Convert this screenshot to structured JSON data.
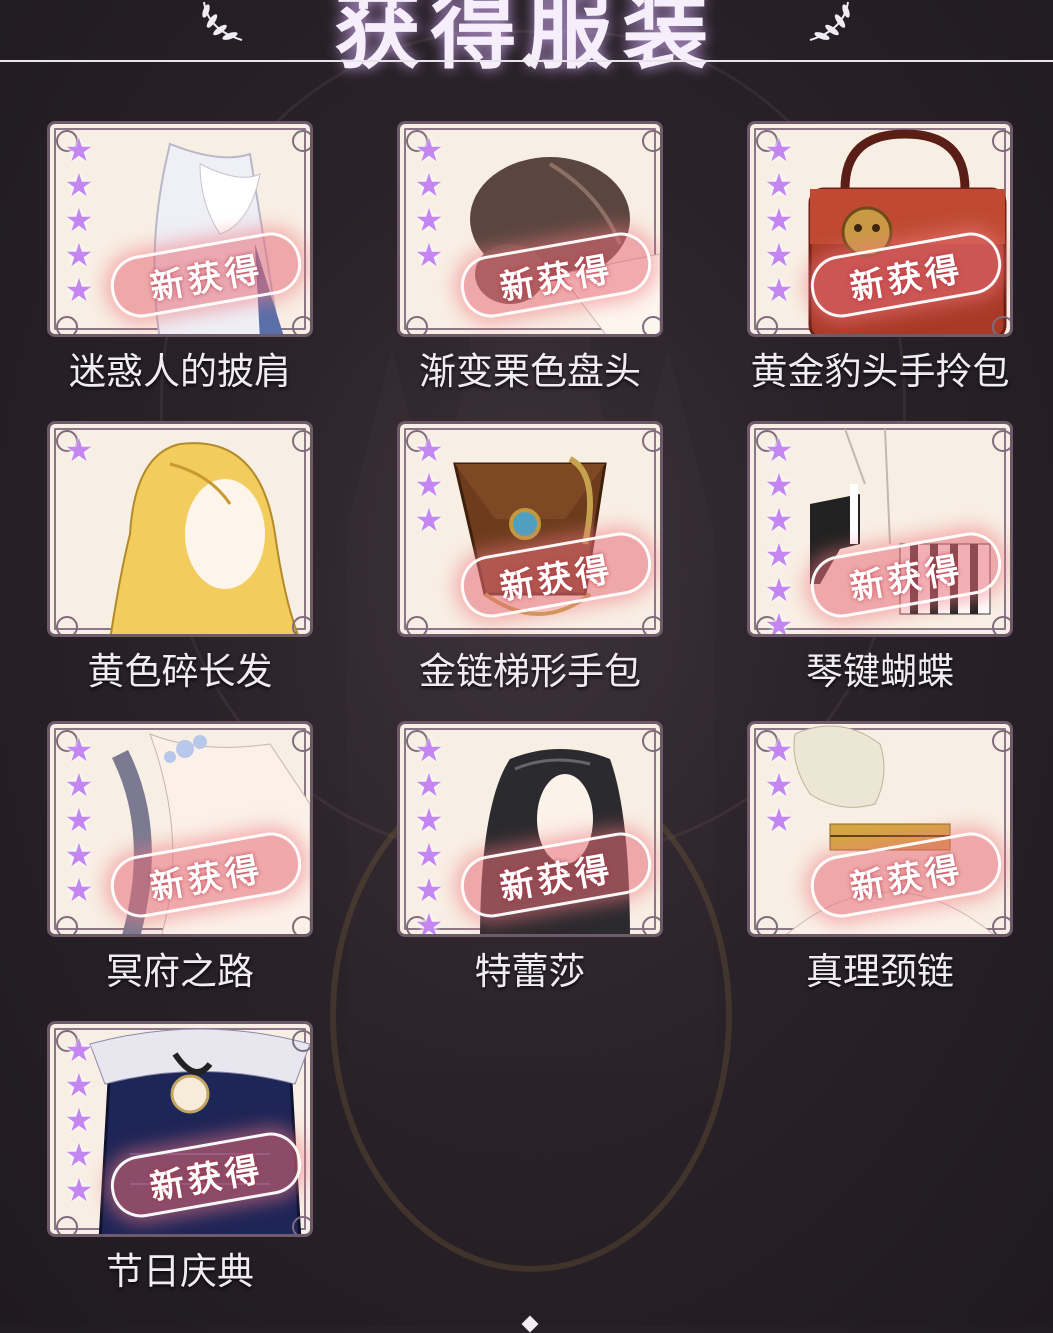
{
  "header": {
    "title": "获得服装",
    "laurel_icon": "laurel-icon"
  },
  "colors": {
    "background": "#2a2229",
    "star": "#c486f0",
    "stamp": "#e86e78",
    "card_bg": "#f8efe4",
    "caption": "#f1ecef"
  },
  "stamp_text": "新获得",
  "star_glyph": "★",
  "items": [
    {
      "name": "迷惑人的披肩",
      "stars": 5,
      "new": true,
      "art": "shawl"
    },
    {
      "name": "渐变栗色盘头",
      "stars": 4,
      "new": true,
      "art": "brown-bun-hair"
    },
    {
      "name": "黄金豹头手拎包",
      "stars": 5,
      "new": true,
      "art": "red-handbag"
    },
    {
      "name": "黄色碎长发",
      "stars": 1,
      "new": false,
      "art": "blonde-long-hair"
    },
    {
      "name": "金链梯形手包",
      "stars": 3,
      "new": true,
      "art": "brown-clutch"
    },
    {
      "name": "琴键蝴蝶",
      "stars": 6,
      "new": true,
      "art": "piano-heels"
    },
    {
      "name": "冥府之路",
      "stars": 5,
      "new": true,
      "art": "braid-outfit"
    },
    {
      "name": "特蕾莎",
      "stars": 6,
      "new": true,
      "art": "black-long-hair"
    },
    {
      "name": "真理颈链",
      "stars": 3,
      "new": true,
      "art": "gold-necklace"
    },
    {
      "name": "节日庆典",
      "stars": 5,
      "new": true,
      "art": "navy-dress"
    }
  ]
}
